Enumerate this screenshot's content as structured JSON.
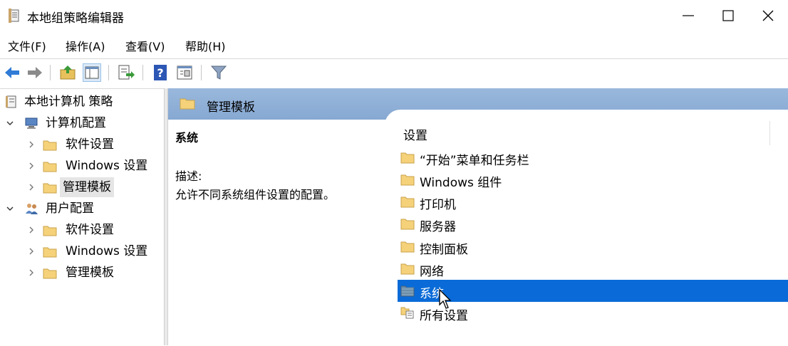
{
  "window": {
    "title": "本地组策略编辑器"
  },
  "menu": {
    "items": [
      "文件(F)",
      "操作(A)",
      "查看(V)",
      "帮助(H)"
    ]
  },
  "toolbar": {
    "buttons": [
      "back-icon",
      "forward-icon",
      "up-folder-icon",
      "show-hide-tree-icon",
      "export-list-icon",
      "help-icon",
      "properties-icon",
      "filter-icon"
    ]
  },
  "tree": {
    "root": "本地计算机 策略",
    "computer": {
      "label": "计算机配置",
      "children": [
        "软件设置",
        "Windows 设置",
        "管理模板"
      ]
    },
    "user": {
      "label": "用户配置",
      "children": [
        "软件设置",
        "Windows 设置",
        "管理模板"
      ]
    }
  },
  "right": {
    "header": "管理模板",
    "extended": {
      "title": "系统",
      "description_label": "描述:",
      "description": "允许不同系统组件设置的配置。"
    },
    "list": {
      "column_header": "设置",
      "items": [
        "“开始”菜单和任务栏",
        "Windows 组件",
        "打印机",
        "服务器",
        "控制面板",
        "网络",
        "系统",
        "所有设置"
      ],
      "selected_index": 6
    }
  },
  "colors": {
    "accent": "#0a6bd8",
    "header_band": "#8fb0d8",
    "folder": "#f5d27a"
  }
}
